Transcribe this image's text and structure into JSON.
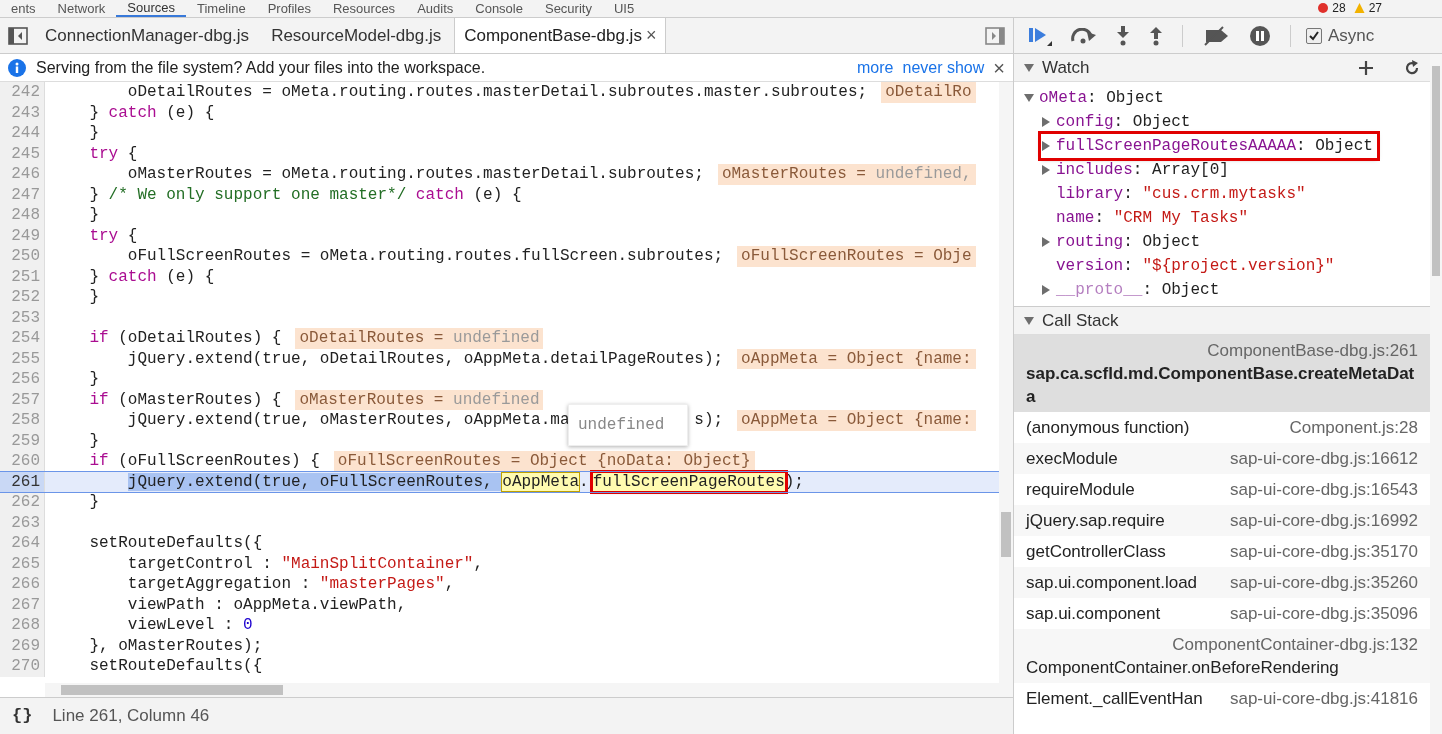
{
  "panel_tabs": [
    {
      "label": "ents",
      "selected": false
    },
    {
      "label": "Network",
      "selected": false
    },
    {
      "label": "Sources",
      "selected": true
    },
    {
      "label": "Timeline",
      "selected": false
    },
    {
      "label": "Profiles",
      "selected": false
    },
    {
      "label": "Resources",
      "selected": false
    },
    {
      "label": "Audits",
      "selected": false
    },
    {
      "label": "Console",
      "selected": false
    },
    {
      "label": "Security",
      "selected": false
    },
    {
      "label": "UI5",
      "selected": false
    }
  ],
  "error_count": "28",
  "warning_count": "27",
  "file_tabs": [
    {
      "label": "ConnectionManager-dbg.js",
      "selected": false
    },
    {
      "label": "ResourceModel-dbg.js",
      "selected": false
    },
    {
      "label": "ComponentBase-dbg.js",
      "selected": true,
      "close": "×"
    }
  ],
  "infobar": {
    "message": "Serving from the file system? Add your files into the workspace.",
    "links": [
      "more",
      "never show"
    ],
    "close": "×"
  },
  "code_lines": [
    {
      "number": "242",
      "current": false,
      "tokens": [
        {
          "kind": "indent"
        },
        {
          "kind": "indent"
        },
        {
          "kind": "plain",
          "text": "oDetailRoutes = oMeta.routing.routes.masterDetail.subroutes.master.subroutes;"
        }
      ],
      "inline_value": [
        {
          "kind": "label",
          "text": "oDetailRo"
        }
      ]
    },
    {
      "number": "243",
      "current": false,
      "tokens": [
        {
          "kind": "indent"
        },
        {
          "kind": "plain",
          "text": "} "
        },
        {
          "kind": "keyword",
          "text": "catch"
        },
        {
          "kind": "plain",
          "text": " (e) {"
        }
      ]
    },
    {
      "number": "244",
      "current": false,
      "tokens": [
        {
          "kind": "indent"
        },
        {
          "kind": "plain",
          "text": "}"
        }
      ]
    },
    {
      "number": "245",
      "current": false,
      "tokens": [
        {
          "kind": "indent"
        },
        {
          "kind": "keyword",
          "text": "try"
        },
        {
          "kind": "plain",
          "text": " {"
        }
      ]
    },
    {
      "number": "246",
      "current": false,
      "tokens": [
        {
          "kind": "indent"
        },
        {
          "kind": "indent"
        },
        {
          "kind": "plain",
          "text": "oMasterRoutes = oMeta.routing.routes.masterDetail.subroutes;"
        }
      ],
      "inline_value": [
        {
          "kind": "label",
          "text": "oMasterRoutes = "
        },
        {
          "kind": "value",
          "text": "undefined,"
        }
      ]
    },
    {
      "number": "247",
      "current": false,
      "tokens": [
        {
          "kind": "indent"
        },
        {
          "kind": "plain",
          "text": "} "
        },
        {
          "kind": "comment",
          "text": "/* We only support one master*/"
        },
        {
          "kind": "keyword",
          "text": " catch"
        },
        {
          "kind": "plain",
          "text": " (e) {"
        }
      ]
    },
    {
      "number": "248",
      "current": false,
      "tokens": [
        {
          "kind": "indent"
        },
        {
          "kind": "plain",
          "text": "}"
        }
      ]
    },
    {
      "number": "249",
      "current": false,
      "tokens": [
        {
          "kind": "indent"
        },
        {
          "kind": "keyword",
          "text": "try"
        },
        {
          "kind": "plain",
          "text": " {"
        }
      ]
    },
    {
      "number": "250",
      "current": false,
      "tokens": [
        {
          "kind": "indent"
        },
        {
          "kind": "indent"
        },
        {
          "kind": "plain",
          "text": "oFullScreenRoutes = oMeta.routing.routes.fullScreen.subroutes;"
        }
      ],
      "inline_value": [
        {
          "kind": "label",
          "text": "oFullScreenRoutes = Obje"
        }
      ]
    },
    {
      "number": "251",
      "current": false,
      "tokens": [
        {
          "kind": "indent"
        },
        {
          "kind": "plain",
          "text": "} "
        },
        {
          "kind": "keyword",
          "text": "catch"
        },
        {
          "kind": "plain",
          "text": " (e) {"
        }
      ]
    },
    {
      "number": "252",
      "current": false,
      "tokens": [
        {
          "kind": "indent"
        },
        {
          "kind": "plain",
          "text": "}"
        }
      ]
    },
    {
      "number": "253",
      "current": false
    },
    {
      "number": "254",
      "current": false,
      "tokens": [
        {
          "kind": "indent"
        },
        {
          "kind": "keyword",
          "text": "if"
        },
        {
          "kind": "plain",
          "text": " (oDetailRoutes) {"
        }
      ],
      "inline_value": [
        {
          "kind": "label",
          "text": "oDetailRoutes = "
        },
        {
          "kind": "value",
          "text": "undefined"
        }
      ]
    },
    {
      "number": "255",
      "current": false,
      "tokens": [
        {
          "kind": "indent"
        },
        {
          "kind": "indent"
        },
        {
          "kind": "plain",
          "text": "jQuery.extend(true, oDetailRoutes, oAppMeta.detailPageRoutes);"
        }
      ],
      "inline_value": [
        {
          "kind": "label",
          "text": "oAppMeta = Object {name:"
        }
      ]
    },
    {
      "number": "256",
      "current": false,
      "tokens": [
        {
          "kind": "indent"
        },
        {
          "kind": "plain",
          "text": "}"
        }
      ]
    },
    {
      "number": "257",
      "current": false,
      "tokens": [
        {
          "kind": "indent"
        },
        {
          "kind": "keyword",
          "text": "if"
        },
        {
          "kind": "plain",
          "text": " (oMasterRoutes) {"
        }
      ],
      "inline_value": [
        {
          "kind": "label",
          "text": "oMasterRoutes = "
        },
        {
          "kind": "value",
          "text": "undefined"
        }
      ]
    },
    {
      "number": "258",
      "current": false,
      "tokens": [
        {
          "kind": "indent"
        },
        {
          "kind": "indent"
        },
        {
          "kind": "plain",
          "text": "jQuery.extend(true, oMasterRoutes, oAppMeta.ma"
        },
        {
          "kind": "covered"
        },
        {
          "kind": "plain",
          "text": "s);"
        }
      ],
      "inline_value": [
        {
          "kind": "label",
          "text": "oAppMeta = Object {name:"
        }
      ]
    },
    {
      "number": "259",
      "current": false,
      "tokens": [
        {
          "kind": "indent"
        },
        {
          "kind": "plain",
          "text": "}"
        }
      ]
    },
    {
      "number": "260",
      "current": false,
      "tokens": [
        {
          "kind": "indent"
        },
        {
          "kind": "keyword",
          "text": "if"
        },
        {
          "kind": "plain",
          "text": " (oFullScreenRoutes) {"
        }
      ],
      "inline_value": [
        {
          "kind": "label",
          "text": "oFullScreenRoutes = Object {noData: Object}"
        }
      ]
    },
    {
      "number": "261",
      "current": true,
      "tokens": [
        {
          "kind": "indent"
        },
        {
          "kind": "indent"
        },
        {
          "kind": "selection",
          "text": "jQuery.extend(true, oFullScreenRoutes, "
        },
        {
          "kind": "hover",
          "text": "oAppMeta"
        },
        {
          "kind": "plain",
          "text": "."
        },
        {
          "kind": "boxed",
          "text": "fullScreenPageRoutes"
        },
        {
          "kind": "plain",
          "text": ");"
        }
      ]
    },
    {
      "number": "262",
      "current": false,
      "tokens": [
        {
          "kind": "indent"
        },
        {
          "kind": "plain",
          "text": "}"
        }
      ]
    },
    {
      "number": "263",
      "current": false
    },
    {
      "number": "264",
      "current": false,
      "tokens": [
        {
          "kind": "indent"
        },
        {
          "kind": "plain",
          "text": "setRouteDefaults({"
        }
      ]
    },
    {
      "number": "265",
      "current": false,
      "tokens": [
        {
          "kind": "indent"
        },
        {
          "kind": "indent"
        },
        {
          "kind": "plain",
          "text": "targetControl : "
        },
        {
          "kind": "string",
          "text": "\"MainSplitContainer\""
        },
        {
          "kind": "plain",
          "text": ","
        }
      ]
    },
    {
      "number": "266",
      "current": false,
      "tokens": [
        {
          "kind": "indent"
        },
        {
          "kind": "indent"
        },
        {
          "kind": "plain",
          "text": "targetAggregation : "
        },
        {
          "kind": "string",
          "text": "\"masterPages\""
        },
        {
          "kind": "plain",
          "text": ","
        }
      ]
    },
    {
      "number": "267",
      "current": false,
      "tokens": [
        {
          "kind": "indent"
        },
        {
          "kind": "indent"
        },
        {
          "kind": "plain",
          "text": "viewPath : oAppMeta.viewPath,"
        }
      ]
    },
    {
      "number": "268",
      "current": false,
      "tokens": [
        {
          "kind": "indent"
        },
        {
          "kind": "indent"
        },
        {
          "kind": "plain",
          "text": "viewLevel : "
        },
        {
          "kind": "number",
          "text": "0"
        }
      ]
    },
    {
      "number": "269",
      "current": false,
      "tokens": [
        {
          "kind": "indent"
        },
        {
          "kind": "plain",
          "text": "}, oMasterRoutes);"
        }
      ]
    },
    {
      "number": "270",
      "current": false,
      "tokens": [
        {
          "kind": "indent"
        },
        {
          "kind": "plain",
          "text": "setRouteDefaults({"
        }
      ]
    }
  ],
  "tooltip": "undefined",
  "status_bar": {
    "format_button": "{}",
    "position": "Line 261, Column 46"
  },
  "debugger_toolbar": {
    "async_label": "Async",
    "async_checked": true
  },
  "watch": {
    "title": "Watch",
    "expanded": true,
    "items": [
      {
        "key": "oMeta",
        "separator": ":",
        "value": "Object",
        "kind": "object",
        "expanded": true,
        "internal": false,
        "marked": false,
        "children": [
          {
            "key": "config",
            "separator": ":",
            "value": "Object",
            "kind": "object",
            "expanded": false,
            "internal": false,
            "marked": false
          },
          {
            "key": "fullScreenPageRoutesAAAAA",
            "separator": ":",
            "value": "Object",
            "kind": "object",
            "expanded": false,
            "internal": false,
            "marked": true
          },
          {
            "key": "includes",
            "separator": ":",
            "value": "Array[0]",
            "kind": "object",
            "expanded": false,
            "internal": false,
            "marked": false
          },
          {
            "key": "library",
            "separator": ":",
            "value": "\"cus.crm.mytasks\"",
            "kind": "string",
            "internal": false,
            "marked": false
          },
          {
            "key": "name",
            "separator": ":",
            "value": "\"CRM My Tasks\"",
            "kind": "string",
            "internal": false,
            "marked": false
          },
          {
            "key": "routing",
            "separator": ":",
            "value": "Object",
            "kind": "object",
            "expanded": false,
            "internal": false,
            "marked": false
          },
          {
            "key": "version",
            "separator": ":",
            "value": "\"${project.version}\"",
            "kind": "string",
            "internal": false,
            "marked": false
          },
          {
            "key": "__proto__",
            "separator": ":",
            "value": "Object",
            "kind": "object",
            "expanded": false,
            "internal": true,
            "marked": false
          }
        ]
      }
    ]
  },
  "call_stack": {
    "title": "Call Stack",
    "expanded": true,
    "frames": [
      {
        "function": "sap.ca.scfld.md.ComponentBase.createMetaData",
        "location": "ComponentBase-dbg.js:261",
        "selected": true,
        "kind": "two_line"
      },
      {
        "function": "(anonymous function)",
        "location": "Component.js:28",
        "selected": false,
        "kind": "one_line"
      },
      {
        "function": "execModule",
        "location": "sap-ui-core-dbg.js:16612",
        "selected": false,
        "kind": "one_line"
      },
      {
        "function": "requireModule",
        "location": "sap-ui-core-dbg.js:16543",
        "selected": false,
        "kind": "one_line"
      },
      {
        "function": "jQuery.sap.require",
        "location": "sap-ui-core-dbg.js:16992",
        "selected": false,
        "kind": "one_line"
      },
      {
        "function": "getControllerClass",
        "location": "sap-ui-core-dbg.js:35170",
        "selected": false,
        "kind": "one_line"
      },
      {
        "function": "sap.ui.component.load",
        "location": "sap-ui-core-dbg.js:35260",
        "selected": false,
        "kind": "one_line"
      },
      {
        "function": "sap.ui.component",
        "location": "sap-ui-core-dbg.js:35096",
        "selected": false,
        "kind": "one_line"
      },
      {
        "function": "ComponentContainer.onBeforeRendering",
        "location": "ComponentContainer-dbg.js:132",
        "selected": false,
        "kind": "two_line"
      },
      {
        "function": "Element._callEventHan",
        "location": "sap-ui-core-dbg.js:41816",
        "selected": false,
        "kind": "one_line"
      }
    ]
  }
}
